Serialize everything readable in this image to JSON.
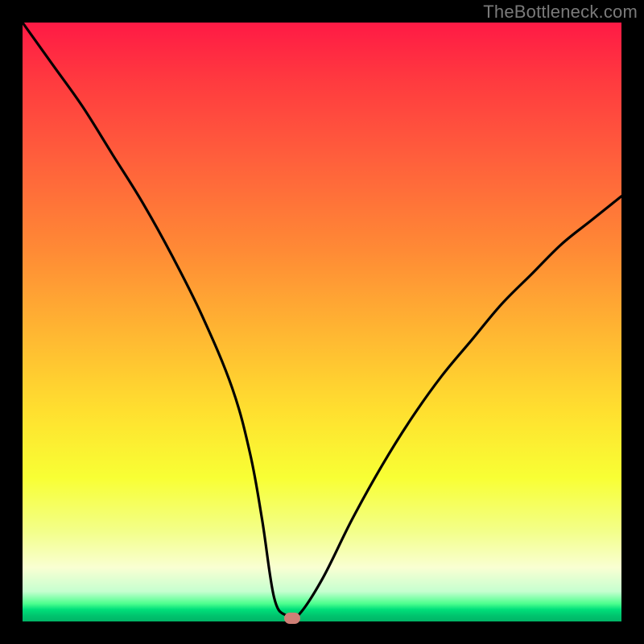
{
  "watermark": "TheBottleneck.com",
  "colors": {
    "frame": "#000000",
    "curve": "#000000",
    "marker": "#cf7f76"
  },
  "chart_data": {
    "type": "line",
    "title": "",
    "xlabel": "",
    "ylabel": "",
    "xlim": [
      0,
      100
    ],
    "ylim": [
      0,
      100
    ],
    "grid": false,
    "series": [
      {
        "name": "bottleneck-curve",
        "x": [
          0,
          5,
          10,
          15,
          20,
          25,
          30,
          35,
          38,
          40,
          42,
          44,
          46,
          50,
          55,
          60,
          65,
          70,
          75,
          80,
          85,
          90,
          95,
          100
        ],
        "y": [
          100,
          93,
          86,
          78,
          70,
          61,
          51,
          39,
          28,
          17,
          4,
          1,
          1,
          7,
          17,
          26,
          34,
          41,
          47,
          53,
          58,
          63,
          67,
          71
        ]
      }
    ],
    "annotations": [
      {
        "name": "optimal-marker",
        "x": 45,
        "y": 0.5
      }
    ],
    "background_gradient": {
      "top": "#ff1a45",
      "mid": "#ffe02f",
      "bottom": "#00b466"
    }
  }
}
